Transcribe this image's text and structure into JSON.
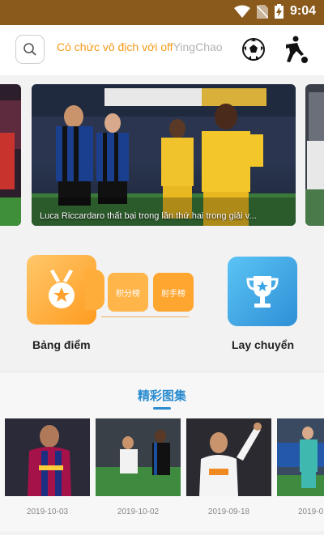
{
  "status_bar": {
    "time": "9:04"
  },
  "search": {
    "marquee_text": "Có chức vô địch với off",
    "marquee_suffix": "YingChao"
  },
  "banner": {
    "caption": "Luca Riccardaro thất bại trong lần thứ hai trong giải v..."
  },
  "features": {
    "standings_label": "Bảng điểm",
    "points_label": "积分榜",
    "scorers_label": "射手榜",
    "cup_label": "Lay chuyển"
  },
  "gallery": {
    "title": "精彩图集",
    "items": [
      {
        "date": "2019-10-03"
      },
      {
        "date": "2019-10-02"
      },
      {
        "date": "2019-09-18"
      },
      {
        "date": "2019-0"
      }
    ]
  },
  "colors": {
    "status_bar": "#8a5a1c",
    "accent_orange": "#f59a1a",
    "accent_blue": "#2a8ccf"
  }
}
